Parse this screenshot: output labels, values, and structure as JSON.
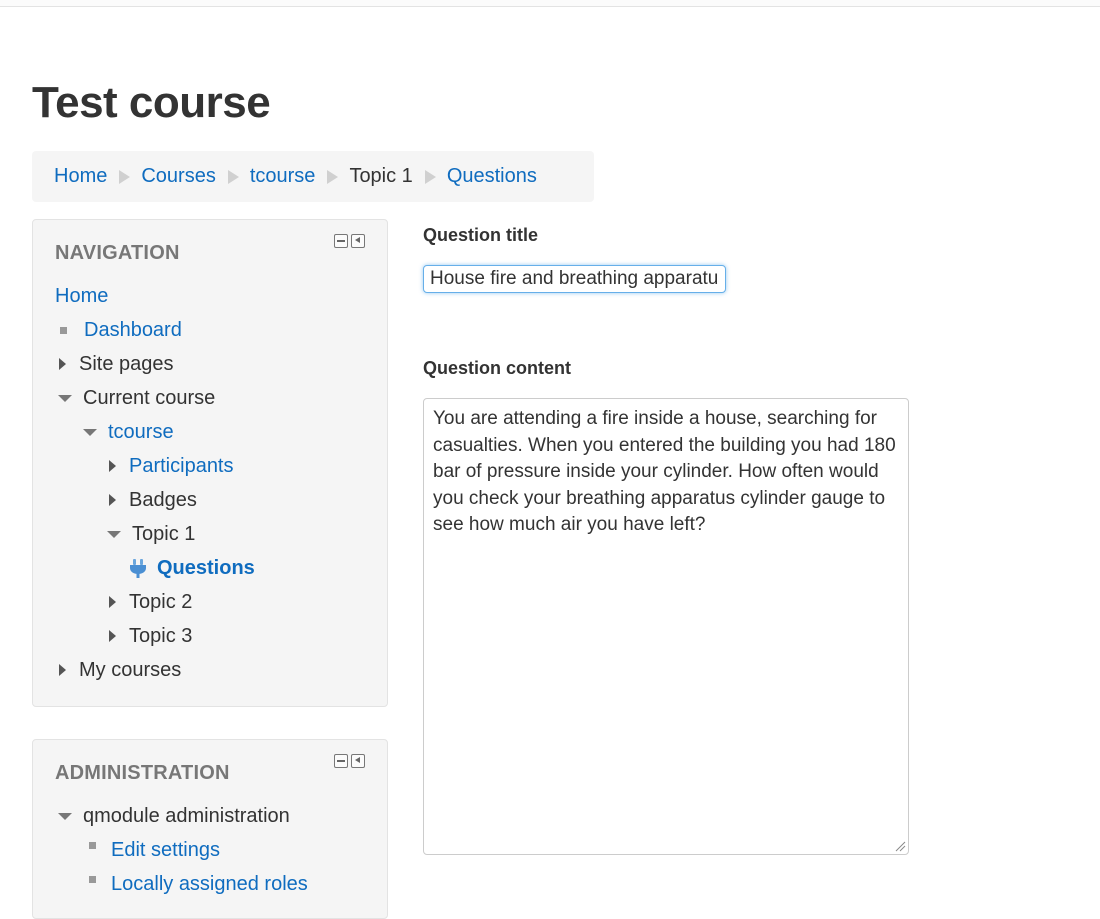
{
  "page": {
    "title": "Test course"
  },
  "breadcrumb": [
    {
      "label": "Home",
      "link": true
    },
    {
      "label": "Courses",
      "link": true
    },
    {
      "label": "tcourse",
      "link": true
    },
    {
      "label": "Topic 1",
      "link": false
    },
    {
      "label": "Questions",
      "link": true
    }
  ],
  "navigation": {
    "title": "NAVIGATION",
    "home": "Home",
    "dashboard": "Dashboard",
    "site_pages": "Site pages",
    "current_course": "Current course",
    "tcourse": "tcourse",
    "participants": "Participants",
    "badges": "Badges",
    "topic1": "Topic 1",
    "questions": "Questions",
    "topic2": "Topic 2",
    "topic3": "Topic 3",
    "my_courses": "My courses"
  },
  "administration": {
    "title": "ADMINISTRATION",
    "qmodule": "qmodule administration",
    "edit_settings": "Edit settings",
    "local_roles": "Locally assigned roles"
  },
  "form": {
    "title_label": "Question title",
    "title_value": "House fire and breathing apparatus",
    "content_label": "Question content",
    "content_value": "You are attending a fire inside a house, searching for casualties. When you entered the building you had 180 bar of pressure inside your cylinder. How often would you check your breathing apparatus cylinder gauge to see how much air you have left?"
  },
  "colors": {
    "link": "#0f6cbf",
    "block_bg": "#f5f5f5",
    "focus": "#66afe9"
  },
  "icons": {
    "questions_item": "plug-icon"
  }
}
